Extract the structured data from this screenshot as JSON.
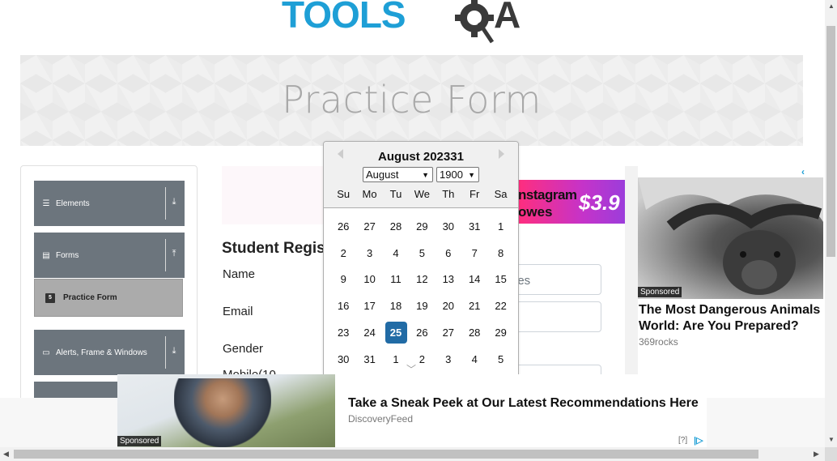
{
  "header": {
    "logo_text": "TOOLSQA"
  },
  "banner": {
    "title": "Practice Form"
  },
  "sidebar": {
    "groups": [
      {
        "label": "Elements",
        "icon": "hamburger-icon",
        "arrow": "download-arrow-icon"
      },
      {
        "label": "Forms",
        "icon": "document-icon",
        "arrow": "upload-arrow-icon"
      },
      {
        "label": "Alerts, Frame & Windows",
        "icon": "window-icon",
        "arrow": "download-arrow-icon"
      }
    ],
    "active_item": {
      "label": "Practice Form",
      "icon": "html5-icon"
    }
  },
  "form": {
    "heading": "Student Regis",
    "labels": {
      "name": "Name",
      "email": "Email",
      "gender": "Gender",
      "mobile": "Mobile(10"
    },
    "input_partial_placeholder": "des"
  },
  "datepicker": {
    "month_title": "August 202331",
    "month_select": "August",
    "year_select": "1900",
    "weekdays": [
      "Su",
      "Mo",
      "Tu",
      "We",
      "Th",
      "Fr",
      "Sa"
    ],
    "weeks": [
      [
        "26",
        "27",
        "28",
        "29",
        "30",
        "31",
        "1"
      ],
      [
        "2",
        "3",
        "4",
        "5",
        "6",
        "7",
        "8"
      ],
      [
        "9",
        "10",
        "11",
        "12",
        "13",
        "14",
        "15"
      ],
      [
        "16",
        "17",
        "18",
        "19",
        "20",
        "21",
        "22"
      ],
      [
        "23",
        "24",
        "25",
        "26",
        "27",
        "28",
        "29"
      ],
      [
        "30",
        "31",
        "1",
        "2",
        "3",
        "4",
        "5"
      ]
    ],
    "selected_day": "25"
  },
  "ads": {
    "instagram": {
      "line1": "nstagram",
      "line2": "owes",
      "price": "$3.9"
    },
    "right": {
      "sponsored": "Sponsored",
      "headline": "The Most Dangerous Animals World: Are You Prepared?",
      "source": "369rocks"
    },
    "bottom": {
      "sponsored": "Sponsored",
      "headline": "Take a Sneak Peek at Our Latest Recommendations Here",
      "source": "DiscoveryFeed",
      "info": "[?]"
    }
  },
  "colors": {
    "brand_blue": "#1e9fd6",
    "sidebar_gray": "#6c757d",
    "selected_day": "#216ba5"
  }
}
